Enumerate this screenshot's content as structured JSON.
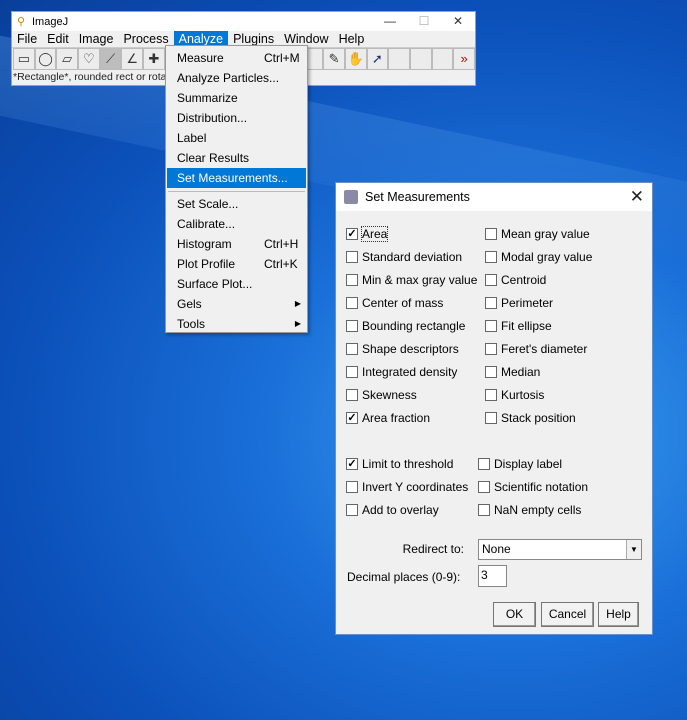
{
  "imagej": {
    "title": "ImageJ",
    "menus": [
      "File",
      "Edit",
      "Image",
      "Process",
      "Analyze",
      "Plugins",
      "Window",
      "Help"
    ],
    "active_menu": "Analyze",
    "status": "*Rectangle*, rounded rect or rotated rect"
  },
  "analyze_menu": {
    "items": [
      {
        "label": "Measure",
        "shortcut": "Ctrl+M"
      },
      {
        "label": "Analyze Particles..."
      },
      {
        "label": "Summarize"
      },
      {
        "label": "Distribution..."
      },
      {
        "label": "Label"
      },
      {
        "label": "Clear Results"
      },
      {
        "label": "Set Measurements...",
        "highlighted": true
      },
      {
        "label": "Set Scale..."
      },
      {
        "label": "Calibrate..."
      },
      {
        "label": "Histogram",
        "shortcut": "Ctrl+H"
      },
      {
        "label": "Plot Profile",
        "shortcut": "Ctrl+K"
      },
      {
        "label": "Surface Plot..."
      },
      {
        "label": "Gels",
        "submenu": true
      },
      {
        "label": "Tools",
        "submenu": true
      }
    ]
  },
  "dialog": {
    "title": "Set Measurements",
    "measurements": [
      {
        "label": "Area",
        "checked": true
      },
      {
        "label": "Mean gray value",
        "checked": false
      },
      {
        "label": "Standard deviation",
        "checked": false
      },
      {
        "label": "Modal gray value",
        "checked": false
      },
      {
        "label": "Min & max gray value",
        "checked": false
      },
      {
        "label": "Centroid",
        "checked": false
      },
      {
        "label": "Center of mass",
        "checked": false
      },
      {
        "label": "Perimeter",
        "checked": false
      },
      {
        "label": "Bounding rectangle",
        "checked": false
      },
      {
        "label": "Fit ellipse",
        "checked": false
      },
      {
        "label": "Shape descriptors",
        "checked": false
      },
      {
        "label": "Feret's diameter",
        "checked": false
      },
      {
        "label": "Integrated density",
        "checked": false
      },
      {
        "label": "Median",
        "checked": false
      },
      {
        "label": "Skewness",
        "checked": false
      },
      {
        "label": "Kurtosis",
        "checked": false
      },
      {
        "label": "Area fraction",
        "checked": true
      },
      {
        "label": "Stack position",
        "checked": false
      }
    ],
    "options": [
      {
        "label": "Limit to threshold",
        "checked": true
      },
      {
        "label": "Display label",
        "checked": false
      },
      {
        "label": "Invert Y coordinates",
        "checked": false
      },
      {
        "label": "Scientific notation",
        "checked": false
      },
      {
        "label": "Add to overlay",
        "checked": false
      },
      {
        "label": "NaN empty cells",
        "checked": false
      }
    ],
    "redirect_label": "Redirect to:",
    "redirect_value": "None",
    "decimal_label": "Decimal places (0-9):",
    "decimal_value": "3",
    "ok": "OK",
    "cancel": "Cancel",
    "help": "Help"
  }
}
